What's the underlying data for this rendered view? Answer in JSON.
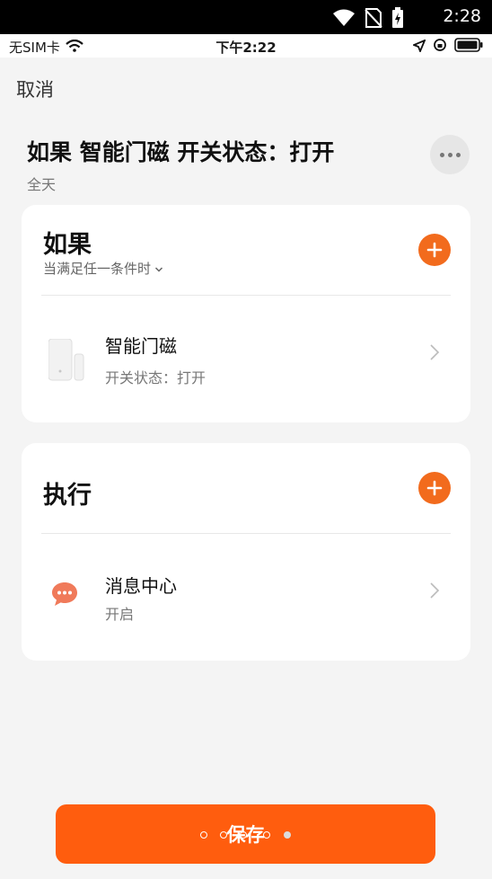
{
  "android_status": {
    "time": "2:28"
  },
  "ios_status": {
    "carrier": "无SIM卡",
    "time": "下午2:22"
  },
  "nav": {
    "cancel_label": "取消"
  },
  "scene": {
    "title": "如果 智能门磁 开关状态：打开",
    "subtitle": "全天"
  },
  "if_section": {
    "title": "如果",
    "condition_mode": "当满足任一条件时",
    "items": [
      {
        "name": "智能门磁",
        "desc": "开关状态：打开"
      }
    ]
  },
  "then_section": {
    "title": "执行",
    "items": [
      {
        "name": "消息中心",
        "desc": "开启"
      }
    ]
  },
  "footer": {
    "save_label": "保存"
  },
  "colors": {
    "accent": "#f26b1d",
    "save": "#ff5d0e",
    "background": "#f4f4f4"
  }
}
